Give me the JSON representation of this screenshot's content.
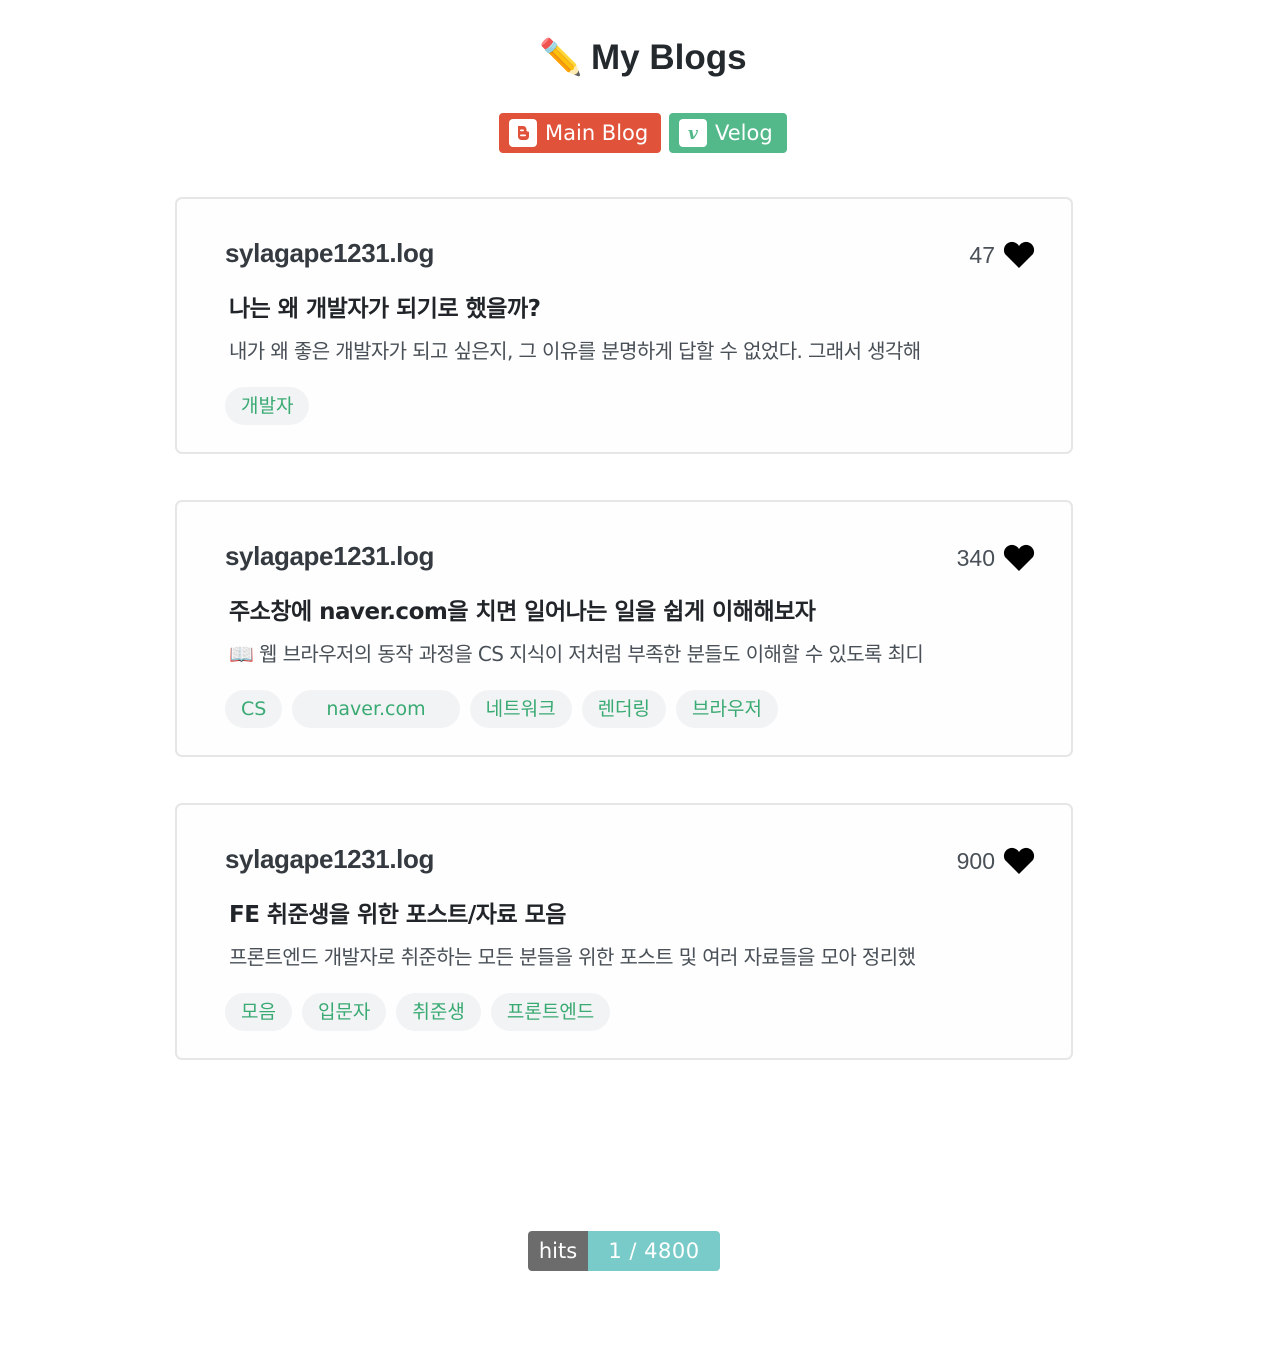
{
  "header": {
    "emoji": "✏️",
    "title": "My Blogs"
  },
  "badges": [
    {
      "label": "Main Blog",
      "icon": "blogger-icon",
      "color": "#e0533a"
    },
    {
      "label": "Velog",
      "icon": "velog-icon",
      "color": "#53b98a"
    }
  ],
  "posts": [
    {
      "author": "sylagape1231.log",
      "likes": "47",
      "title": "나는 왜 개발자가 되기로 했을까?",
      "description": "내가 왜 좋은 개발자가 되고 싶은지, 그 이유를 분명하게 답할 수 없었다. 그래서 생각해",
      "tags": [
        "개발자"
      ]
    },
    {
      "author": "sylagape1231.log",
      "likes": "340",
      "title": "주소창에 naver.com을 치면 일어나는 일을 쉽게 이해해보자",
      "description": "📖 웹 브라우저의 동작 과정을 CS 지식이 저처럼 부족한 분들도 이해할 수 있도록 최디",
      "tags": [
        "CS",
        "naver.com",
        "네트워크",
        "렌더링",
        "브라우저"
      ]
    },
    {
      "author": "sylagape1231.log",
      "likes": "900",
      "title": "FE 취준생을 위한 포스트/자료 모음",
      "description": "프론트엔드 개발자로 취준하는 모든 분들을 위한 포스트 및 여러 자료들을 모아 정리했",
      "tags": [
        "모음",
        "입문자",
        "취준생",
        "프론트엔드"
      ]
    }
  ],
  "hits": {
    "label": "hits",
    "value": "1 / 4800"
  },
  "colors": {
    "tag_text": "#3aaa73",
    "tag_bg": "#f1f3f5",
    "card_border": "#e6e6e6"
  }
}
